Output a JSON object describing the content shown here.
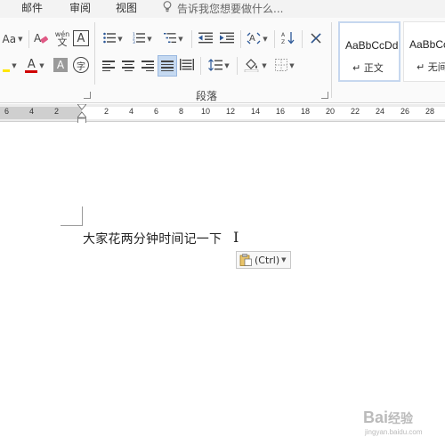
{
  "tabs": {
    "mail": "邮件",
    "review": "审阅",
    "view": "视图"
  },
  "tell_me": {
    "text": "告诉我您想要做什么..."
  },
  "ribbon": {
    "font_size_grow": "Aa",
    "phonetic_top": "wén",
    "phonetic_bottom": "文",
    "char_border": "A",
    "font_color": "A",
    "char_shading": "A",
    "enclose_char": "字",
    "group_label": "段落"
  },
  "styles": [
    {
      "sample": "AaBbCcDd",
      "name": "↵ 正文"
    },
    {
      "sample": "AaBbCcDd",
      "name": "↵ 无间"
    }
  ],
  "ruler": {
    "ticks": [
      "6",
      "4",
      "2",
      "2",
      "4",
      "6",
      "8",
      "10",
      "12",
      "14",
      "16",
      "18",
      "20",
      "22",
      "24",
      "26",
      "28"
    ]
  },
  "document": {
    "text": "大家花两分钟时间记一下"
  },
  "paste_options": {
    "label": "(Ctrl)"
  },
  "watermark": {
    "brand": "Bai",
    "suffix": "经验",
    "url": "jingyan.baidu.com"
  },
  "colors": {
    "font_color_bar": "#d00000",
    "highlight_bar": "#ffe600",
    "selected_button": "#c5d9f1",
    "style_selected_border": "#c6d7ef"
  },
  "icons": [
    "lightbulb-icon",
    "eraser-icon",
    "bullets-icon",
    "numbering-icon",
    "multilevel-list-icon",
    "decrease-indent-icon",
    "increase-indent-icon",
    "chinese-layout-icon",
    "sort-icon",
    "show-marks-icon",
    "align-left-icon",
    "center-icon",
    "align-right-icon",
    "justify-icon",
    "distributed-icon",
    "line-spacing-icon",
    "shading-icon",
    "borders-icon",
    "clipboard-icon",
    "ibeam-cursor-icon"
  ]
}
